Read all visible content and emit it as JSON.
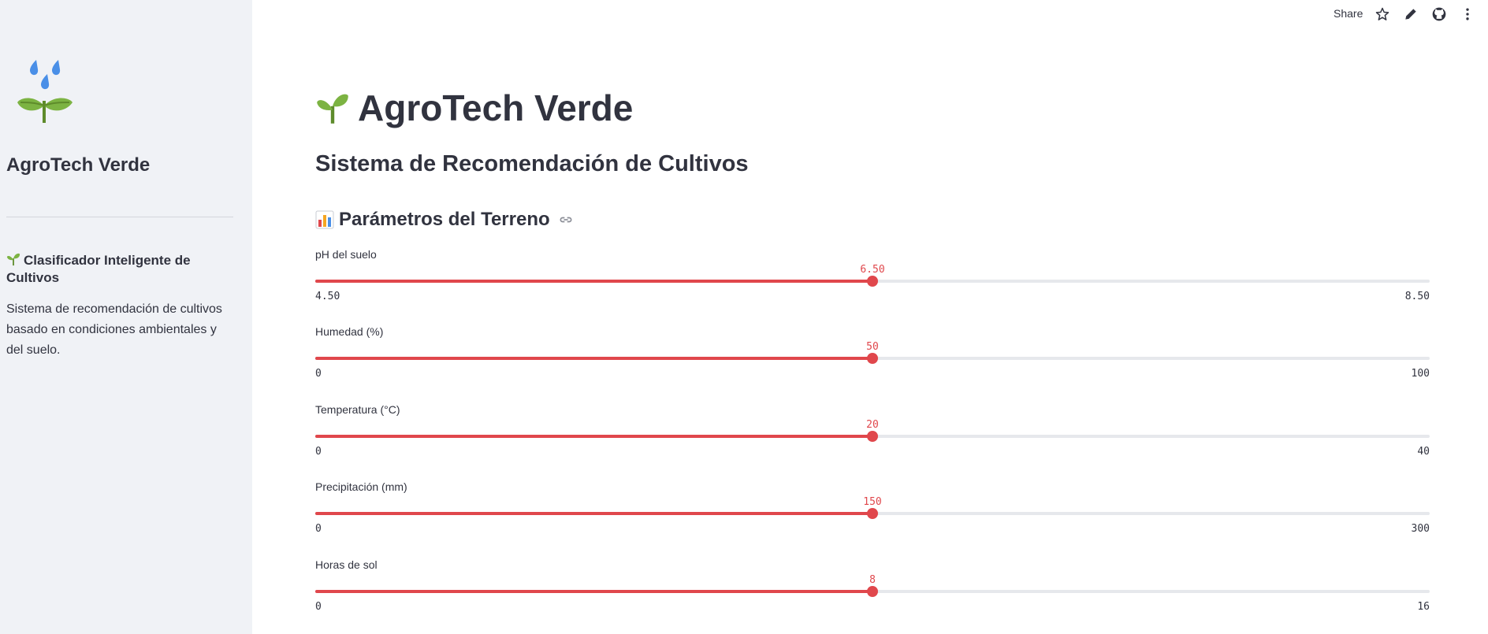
{
  "sidebar": {
    "title": "AgroTech Verde",
    "subtitle": "Clasificador Inteligente de Cultivos",
    "description": "Sistema de recomendación de cultivos basado en condiciones ambientales y del suelo."
  },
  "topbar": {
    "share_label": "Share",
    "icons": [
      "star-icon",
      "pencil-icon",
      "github-icon",
      "more-vert-icon"
    ]
  },
  "main": {
    "title": "AgroTech Verde",
    "subtitle": "Sistema de Recomendación de Cultivos",
    "section_title": "Parámetros del Terreno"
  },
  "sliders": [
    {
      "label": "pH del suelo",
      "value": "6.50",
      "min": "4.50",
      "max": "8.50",
      "fraction": 0.5
    },
    {
      "label": "Humedad (%)",
      "value": "50",
      "min": "0",
      "max": "100",
      "fraction": 0.5
    },
    {
      "label": "Temperatura (°C)",
      "value": "20",
      "min": "0",
      "max": "40",
      "fraction": 0.5
    },
    {
      "label": "Precipitación (mm)",
      "value": "150",
      "min": "0",
      "max": "300",
      "fraction": 0.5
    },
    {
      "label": "Horas de sol",
      "value": "8",
      "min": "0",
      "max": "16",
      "fraction": 0.5
    }
  ],
  "colors": {
    "accent": "#e0474c",
    "sidebar_bg": "#f0f2f6",
    "text": "#31333f",
    "track": "#e6e8ec"
  }
}
